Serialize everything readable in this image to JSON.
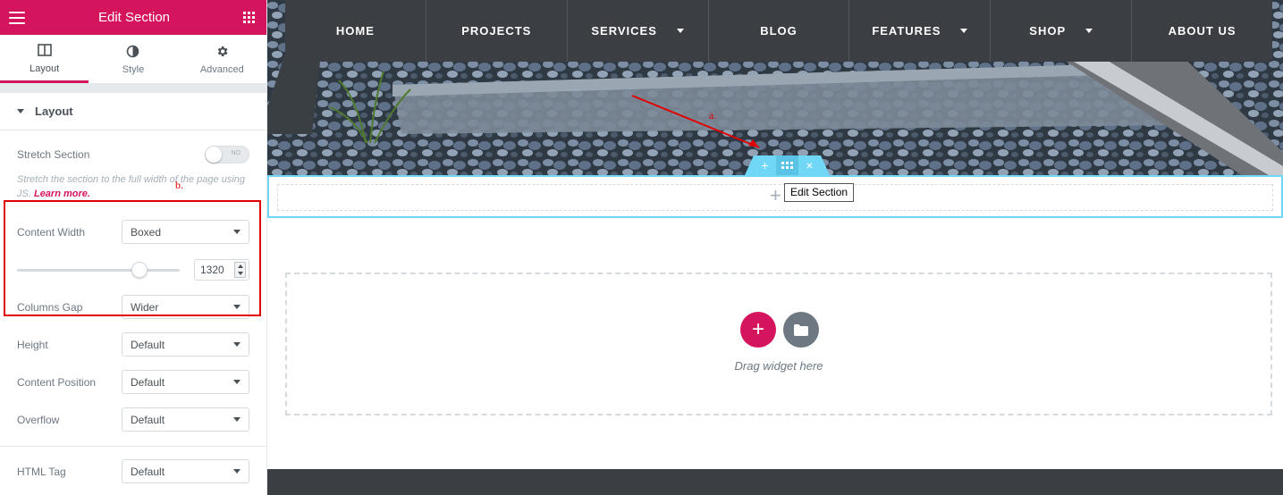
{
  "panel": {
    "title": "Edit Section",
    "tabs": [
      {
        "label": "Layout",
        "icon": "columns-icon"
      },
      {
        "label": "Style",
        "icon": "contrast-icon"
      },
      {
        "label": "Advanced",
        "icon": "gear-icon"
      }
    ],
    "section_heading": "Layout",
    "stretch": {
      "label": "Stretch Section",
      "toggle_text": "NO",
      "description": "Stretch the section to the full width of the page using JS.",
      "learn_more": "Learn more."
    },
    "content_width": {
      "label": "Content Width",
      "value": "Boxed"
    },
    "width_slider": {
      "value": "1320",
      "fraction": 0.75
    },
    "columns_gap": {
      "label": "Columns Gap",
      "value": "Wider"
    },
    "height": {
      "label": "Height",
      "value": "Default"
    },
    "content_position": {
      "label": "Content Position",
      "value": "Default"
    },
    "overflow": {
      "label": "Overflow",
      "value": "Default"
    },
    "html_tag": {
      "label": "HTML Tag",
      "value": "Default"
    },
    "annotations": {
      "a": "a.",
      "b": "b."
    }
  },
  "preview": {
    "nav": [
      "HOME",
      "PROJECTS",
      "SERVICES",
      "BLOG",
      "FEATURES",
      "SHOP",
      "ABOUT US"
    ],
    "nav_dropdowns": [
      false,
      false,
      true,
      false,
      true,
      true,
      false
    ],
    "tooltip": "Edit Section",
    "drop_text": "Drag widget here"
  },
  "colors": {
    "accent": "#d5145e",
    "section_highlight": "#71d7f7",
    "nav_bg": "#3b3e42"
  }
}
